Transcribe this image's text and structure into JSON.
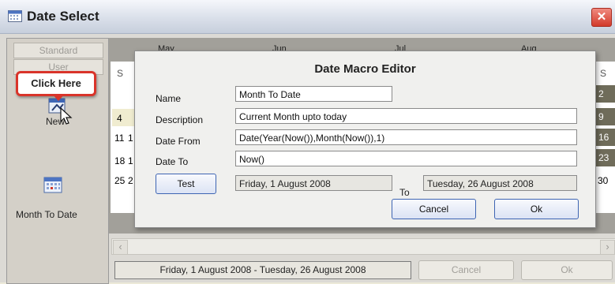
{
  "window": {
    "title": "Date Select",
    "close_glyph": "✕"
  },
  "left_pane": {
    "tabs": [
      "Standard",
      "User"
    ],
    "callout": "Click Here",
    "new_label": "New",
    "month_to_date_label": "Month To Date"
  },
  "calendar": {
    "months": [
      "May",
      "Jun",
      "Jul",
      "Aug"
    ],
    "day_header_left": "S",
    "day_header_right": "S",
    "left_rows": [
      {
        "a": "4",
        "b": ""
      },
      {
        "a": "11",
        "b": "1"
      },
      {
        "a": "18",
        "b": "1"
      },
      {
        "a": "25",
        "b": "2"
      }
    ],
    "right_rows": [
      "2",
      "9",
      "16",
      "23",
      "30"
    ]
  },
  "dialog": {
    "title": "Date Macro Editor",
    "name_label": "Name",
    "name_value": "Month To Date",
    "description_label": "Description",
    "description_value": "Current Month upto today",
    "date_from_label": "Date From",
    "date_from_value": "Date(Year(Now()),Month(Now()),1)",
    "date_to_label": "Date To",
    "date_to_value": "Now()",
    "test_button": "Test",
    "test_from_result": "Friday, 1 August 2008",
    "to_label": "To",
    "test_to_result": "Tuesday, 26 August 2008",
    "cancel_button": "Cancel",
    "ok_button": "Ok"
  },
  "footer": {
    "range_text": "Friday, 1 August 2008 - Tuesday, 26 August 2008",
    "cancel_button": "Cancel",
    "ok_button": "Ok"
  }
}
